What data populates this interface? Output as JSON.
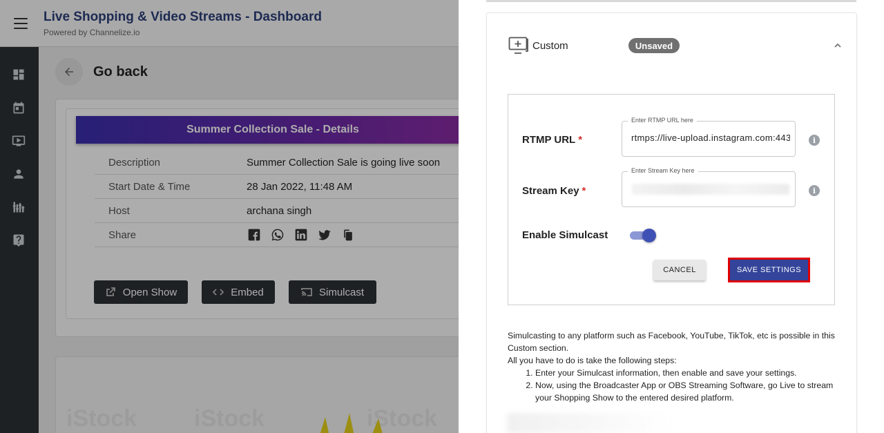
{
  "header": {
    "title": "Live Shopping & Video Streams - Dashboard",
    "subtitle": "Powered by Channelize.io"
  },
  "sidebar": {
    "icons": [
      "dashboard-icon",
      "calendar-icon",
      "video-icon",
      "user-icon",
      "equalizer-icon",
      "help-icon"
    ]
  },
  "goback": {
    "label": "Go back"
  },
  "details": {
    "banner": "Summer Collection Sale - Details",
    "rows": [
      {
        "key": "Description",
        "value": "Summer Collection Sale is going live soon"
      },
      {
        "key": "Start Date & Time",
        "value": "28 Jan 2022, 11:48 AM"
      },
      {
        "key": "Host",
        "value": "archana singh"
      },
      {
        "key": "Share",
        "value": ""
      }
    ],
    "share_icons": [
      "facebook-icon",
      "whatsapp-icon",
      "linkedin-icon",
      "twitter-icon",
      "copy-icon"
    ]
  },
  "actions": {
    "open_show": "Open Show",
    "embed": "Embed",
    "simulcast": "Simulcast"
  },
  "background": {
    "watermark": "iStock"
  },
  "panel": {
    "title": "Custom",
    "badge": "Unsaved",
    "rtmp_label": "RTMP URL",
    "rtmp_legend": "Enter RTMP URL here",
    "rtmp_value": "rtmps://live-upload.instagram.com:443",
    "key_label": "Stream Key",
    "key_legend": "Enter Stream Key here",
    "required_mark": "*",
    "info_glyph": "i",
    "simulcast_label": "Enable Simulcast",
    "simulcast_enabled": true,
    "cancel": "CANCEL",
    "save": "SAVE SETTINGS"
  },
  "help": {
    "line1": "Simulcasting to any platform such as Facebook, YouTube, TikTok, etc is possible in this Custom section.",
    "line2": "All you have to do is take the following steps:",
    "steps": [
      "Enter your Simulcast information, then enable and save your settings.",
      "Now, using the Broadcaster App or OBS Streaming Software, go Live to stream your Shopping Show to the entered desired platform."
    ]
  },
  "colors": {
    "primary": "#3f51b5",
    "save_button": "#33449a",
    "highlight_border": "#e00000",
    "title_blue": "#2c3f7a",
    "sidebar": "#2d3135"
  }
}
